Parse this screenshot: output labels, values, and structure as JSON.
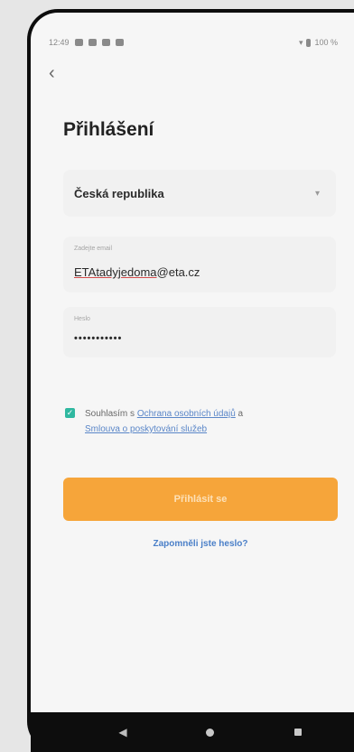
{
  "status": {
    "time": "12:49",
    "battery": "100 %"
  },
  "screen": {
    "title": "Přihlášení"
  },
  "country": {
    "value": "Česká republika"
  },
  "email": {
    "label": "Zadejte email",
    "value_user": "ETAtadyjedoma",
    "value_domain": "@eta.cz"
  },
  "password": {
    "label": "Heslo",
    "value": "•••••••••••"
  },
  "agreement": {
    "prefix": "Souhlasím s ",
    "link1": "Ochrana osobních údajů",
    "mid": " a ",
    "link2": "Smlouva o poskytování služeb"
  },
  "login_button": {
    "label": "Přihlásit se"
  },
  "forgot_link": {
    "label": "Zapomněli jste heslo?"
  }
}
